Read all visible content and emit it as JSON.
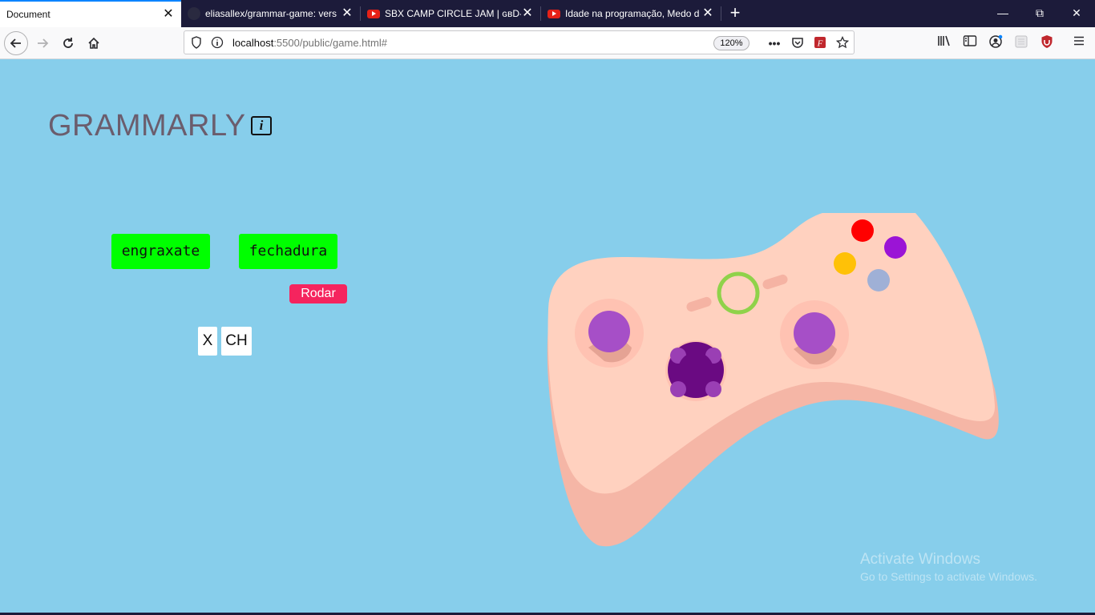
{
  "browser": {
    "tabs": [
      {
        "title": "Document",
        "active": true,
        "favicon": "none"
      },
      {
        "title": "eliasallex/grammar-game: vers",
        "active": false,
        "favicon": "github-icon"
      },
      {
        "title": "SBX CAMP CIRCLE JAM | ɢʙD-L",
        "active": false,
        "favicon": "youtube-icon"
      },
      {
        "title": "Idade na programação, Medo d",
        "active": false,
        "favicon": "youtube-icon"
      }
    ],
    "new_tab_symbol": "+",
    "window_controls": {
      "minimize": "—",
      "restore": "⧉",
      "close": "✕"
    },
    "url": {
      "host": "localhost",
      "rest": ":5500/public/game.html#"
    },
    "zoom": "120%",
    "toolbar_icons": [
      "back-icon",
      "forward-icon",
      "reload-icon",
      "home-icon",
      "shield-icon",
      "info-icon",
      "more-icon",
      "pocket-icon",
      "extension-icon",
      "bookmark-star-icon",
      "library-icon",
      "sidebar-icon",
      "account-icon",
      "container-icon",
      "ublock-icon",
      "menu-icon"
    ]
  },
  "page": {
    "logo": "GRAMMARLY",
    "info_label": "i",
    "words": [
      "engraxate",
      "fechadura"
    ],
    "spin_button": "Rodar",
    "letters": [
      "X",
      "CH"
    ]
  },
  "watermark": {
    "line1": "Activate Windows",
    "line2": "Go to Settings to activate Windows."
  },
  "colors": {
    "page_background": "#87ceeb",
    "word_card": "#00ff00",
    "spin_button": "#f5245e",
    "logo_text": "#6b5d6d"
  }
}
